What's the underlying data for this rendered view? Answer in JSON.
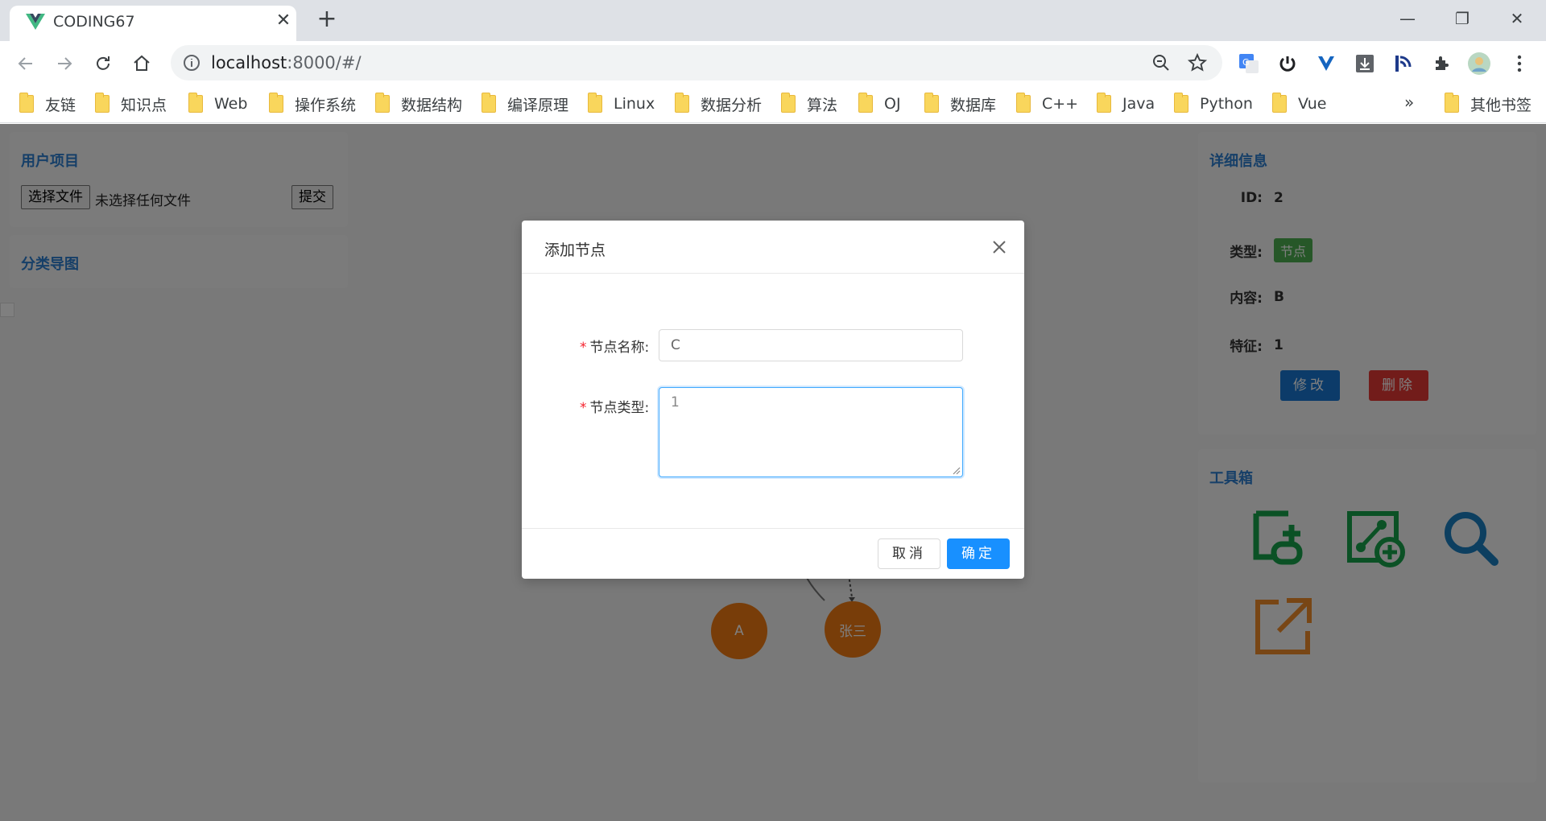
{
  "browser": {
    "tab_title": "CODING67",
    "tab_close": "✕",
    "new_tab": "+",
    "url_host": "localhost",
    "url_path": ":8000/#/",
    "window_controls": [
      "—",
      "❐",
      "✕"
    ],
    "bookmarks": [
      "友链",
      "知识点",
      "Web",
      "操作系统",
      "数据结构",
      "编译原理",
      "Linux",
      "数据分析",
      "算法",
      "OJ",
      "数据库",
      "C++",
      "Java",
      "Python",
      "Vue"
    ],
    "bookmarks_more": "»",
    "other_bookmarks": "其他书签"
  },
  "left_panel": {
    "user_project_title": "用户项目",
    "choose_file_label": "选择文件",
    "no_file_text": "未选择任何文件",
    "submit_label": "提交",
    "category_title": "分类导图"
  },
  "graph": {
    "nodes": [
      {
        "label": "A"
      },
      {
        "label": "张三"
      }
    ]
  },
  "detail_panel": {
    "title": "详细信息",
    "rows": [
      {
        "key": "ID:",
        "value": "2"
      },
      {
        "key": "类型:",
        "value": "节点"
      },
      {
        "key": "内容:",
        "value": "B"
      },
      {
        "key": "特征:",
        "value": "1"
      }
    ],
    "edit_label": "修改",
    "delete_label": "删除"
  },
  "toolbox": {
    "title": "工具箱",
    "tools": [
      "add-node-icon",
      "add-relation-icon",
      "search-icon",
      "export-icon"
    ]
  },
  "modal": {
    "title": "添加节点",
    "name_label": "节点名称:",
    "name_value": "C",
    "type_label": "节点类型:",
    "type_value": "1",
    "required_mark": "*",
    "cancel_label": "取消",
    "ok_label": "确定"
  },
  "colors": {
    "primary": "#1890ff",
    "title_blue": "#2d7fd1",
    "node_orange": "#f07a12",
    "danger": "#e53935",
    "success": "#4caf50",
    "tool_green": "#16a34a",
    "tool_blue": "#1a7fc1",
    "tool_orange": "#f08c2a"
  }
}
